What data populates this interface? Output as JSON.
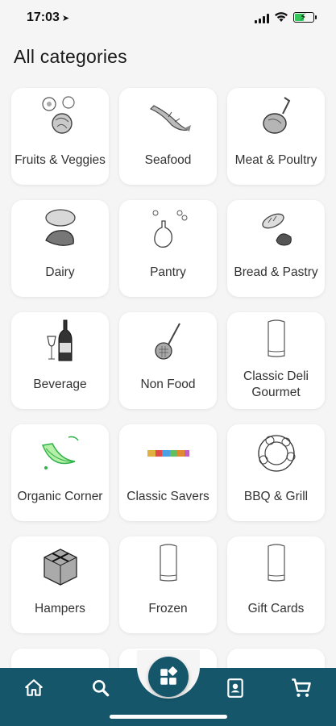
{
  "status_bar": {
    "time": "17:03",
    "location_glyph": "➤"
  },
  "page": {
    "title": "All categories"
  },
  "categories": [
    {
      "label": "Fruits & Veggies",
      "icon": "fruits-veggies-icon"
    },
    {
      "label": "Seafood",
      "icon": "seafood-icon"
    },
    {
      "label": "Meat & Poultry",
      "icon": "meat-poultry-icon"
    },
    {
      "label": "Dairy",
      "icon": "dairy-icon"
    },
    {
      "label": "Pantry",
      "icon": "pantry-icon"
    },
    {
      "label": "Bread & Pastry",
      "icon": "bread-pastry-icon"
    },
    {
      "label": "Beverage",
      "icon": "beverage-icon"
    },
    {
      "label": "Non Food",
      "icon": "non-food-icon"
    },
    {
      "label": "Classic Deli Gourmet",
      "icon": "chef-hat-icon"
    },
    {
      "label": "Organic Corner",
      "icon": "organic-icon"
    },
    {
      "label": "Classic Savers",
      "icon": "classic-savers-icon"
    },
    {
      "label": "BBQ & Grill",
      "icon": "bbq-grill-icon"
    },
    {
      "label": "Hampers",
      "icon": "hamper-icon"
    },
    {
      "label": "Frozen",
      "icon": "chef-hat-icon"
    },
    {
      "label": "Gift Cards",
      "icon": "chef-hat-icon"
    }
  ],
  "bottom_nav": {
    "items": [
      "home-icon",
      "search-icon",
      "categories-icon",
      "account-icon",
      "cart-icon"
    ],
    "active": "categories-icon",
    "color": "#15566a"
  }
}
